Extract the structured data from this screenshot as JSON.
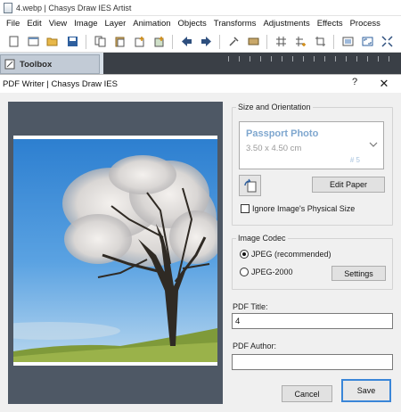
{
  "app": {
    "title": "4.webp | Chasys Draw IES Artist",
    "menu": [
      "File",
      "Edit",
      "View",
      "Image",
      "Layer",
      "Animation",
      "Objects",
      "Transforms",
      "Adjustments",
      "Effects",
      "Process"
    ],
    "toolbar_icons": [
      "new-icon",
      "new-window-icon",
      "open-icon",
      "save-icon",
      "copy-icon",
      "paste-icon",
      "insert-icon",
      "insert-layer-icon",
      "undo-arrow-icon",
      "redo-arrow-icon",
      "tool-icon",
      "frame-icon",
      "grid-icon",
      "grid-add-icon",
      "crop-icon",
      "fit-icon",
      "fullscreen-icon",
      "expand-icon"
    ]
  },
  "toolbox": {
    "label": "Toolbox"
  },
  "dialog": {
    "title": "PDF Writer | Chasys Draw IES",
    "help": "?",
    "close": "✕",
    "size_orientation": {
      "legend": "Size and Orientation",
      "paper_name": "Passport Photo",
      "paper_size": "3.50 x 4.50 cm",
      "paper_index": "# 5",
      "edit_paper": "Edit Paper",
      "ignore_physical_size": "Ignore Image's Physical Size",
      "ignore_checked": false
    },
    "image_codec": {
      "legend": "Image Codec",
      "options": [
        "JPEG (recommended)",
        "JPEG-2000"
      ],
      "selected": 0,
      "settings": "Settings"
    },
    "pdf_title": {
      "label": "PDF Title:",
      "value": "4"
    },
    "pdf_author": {
      "label": "PDF Author:",
      "value": ""
    },
    "cancel": "Cancel",
    "save": "Save"
  }
}
